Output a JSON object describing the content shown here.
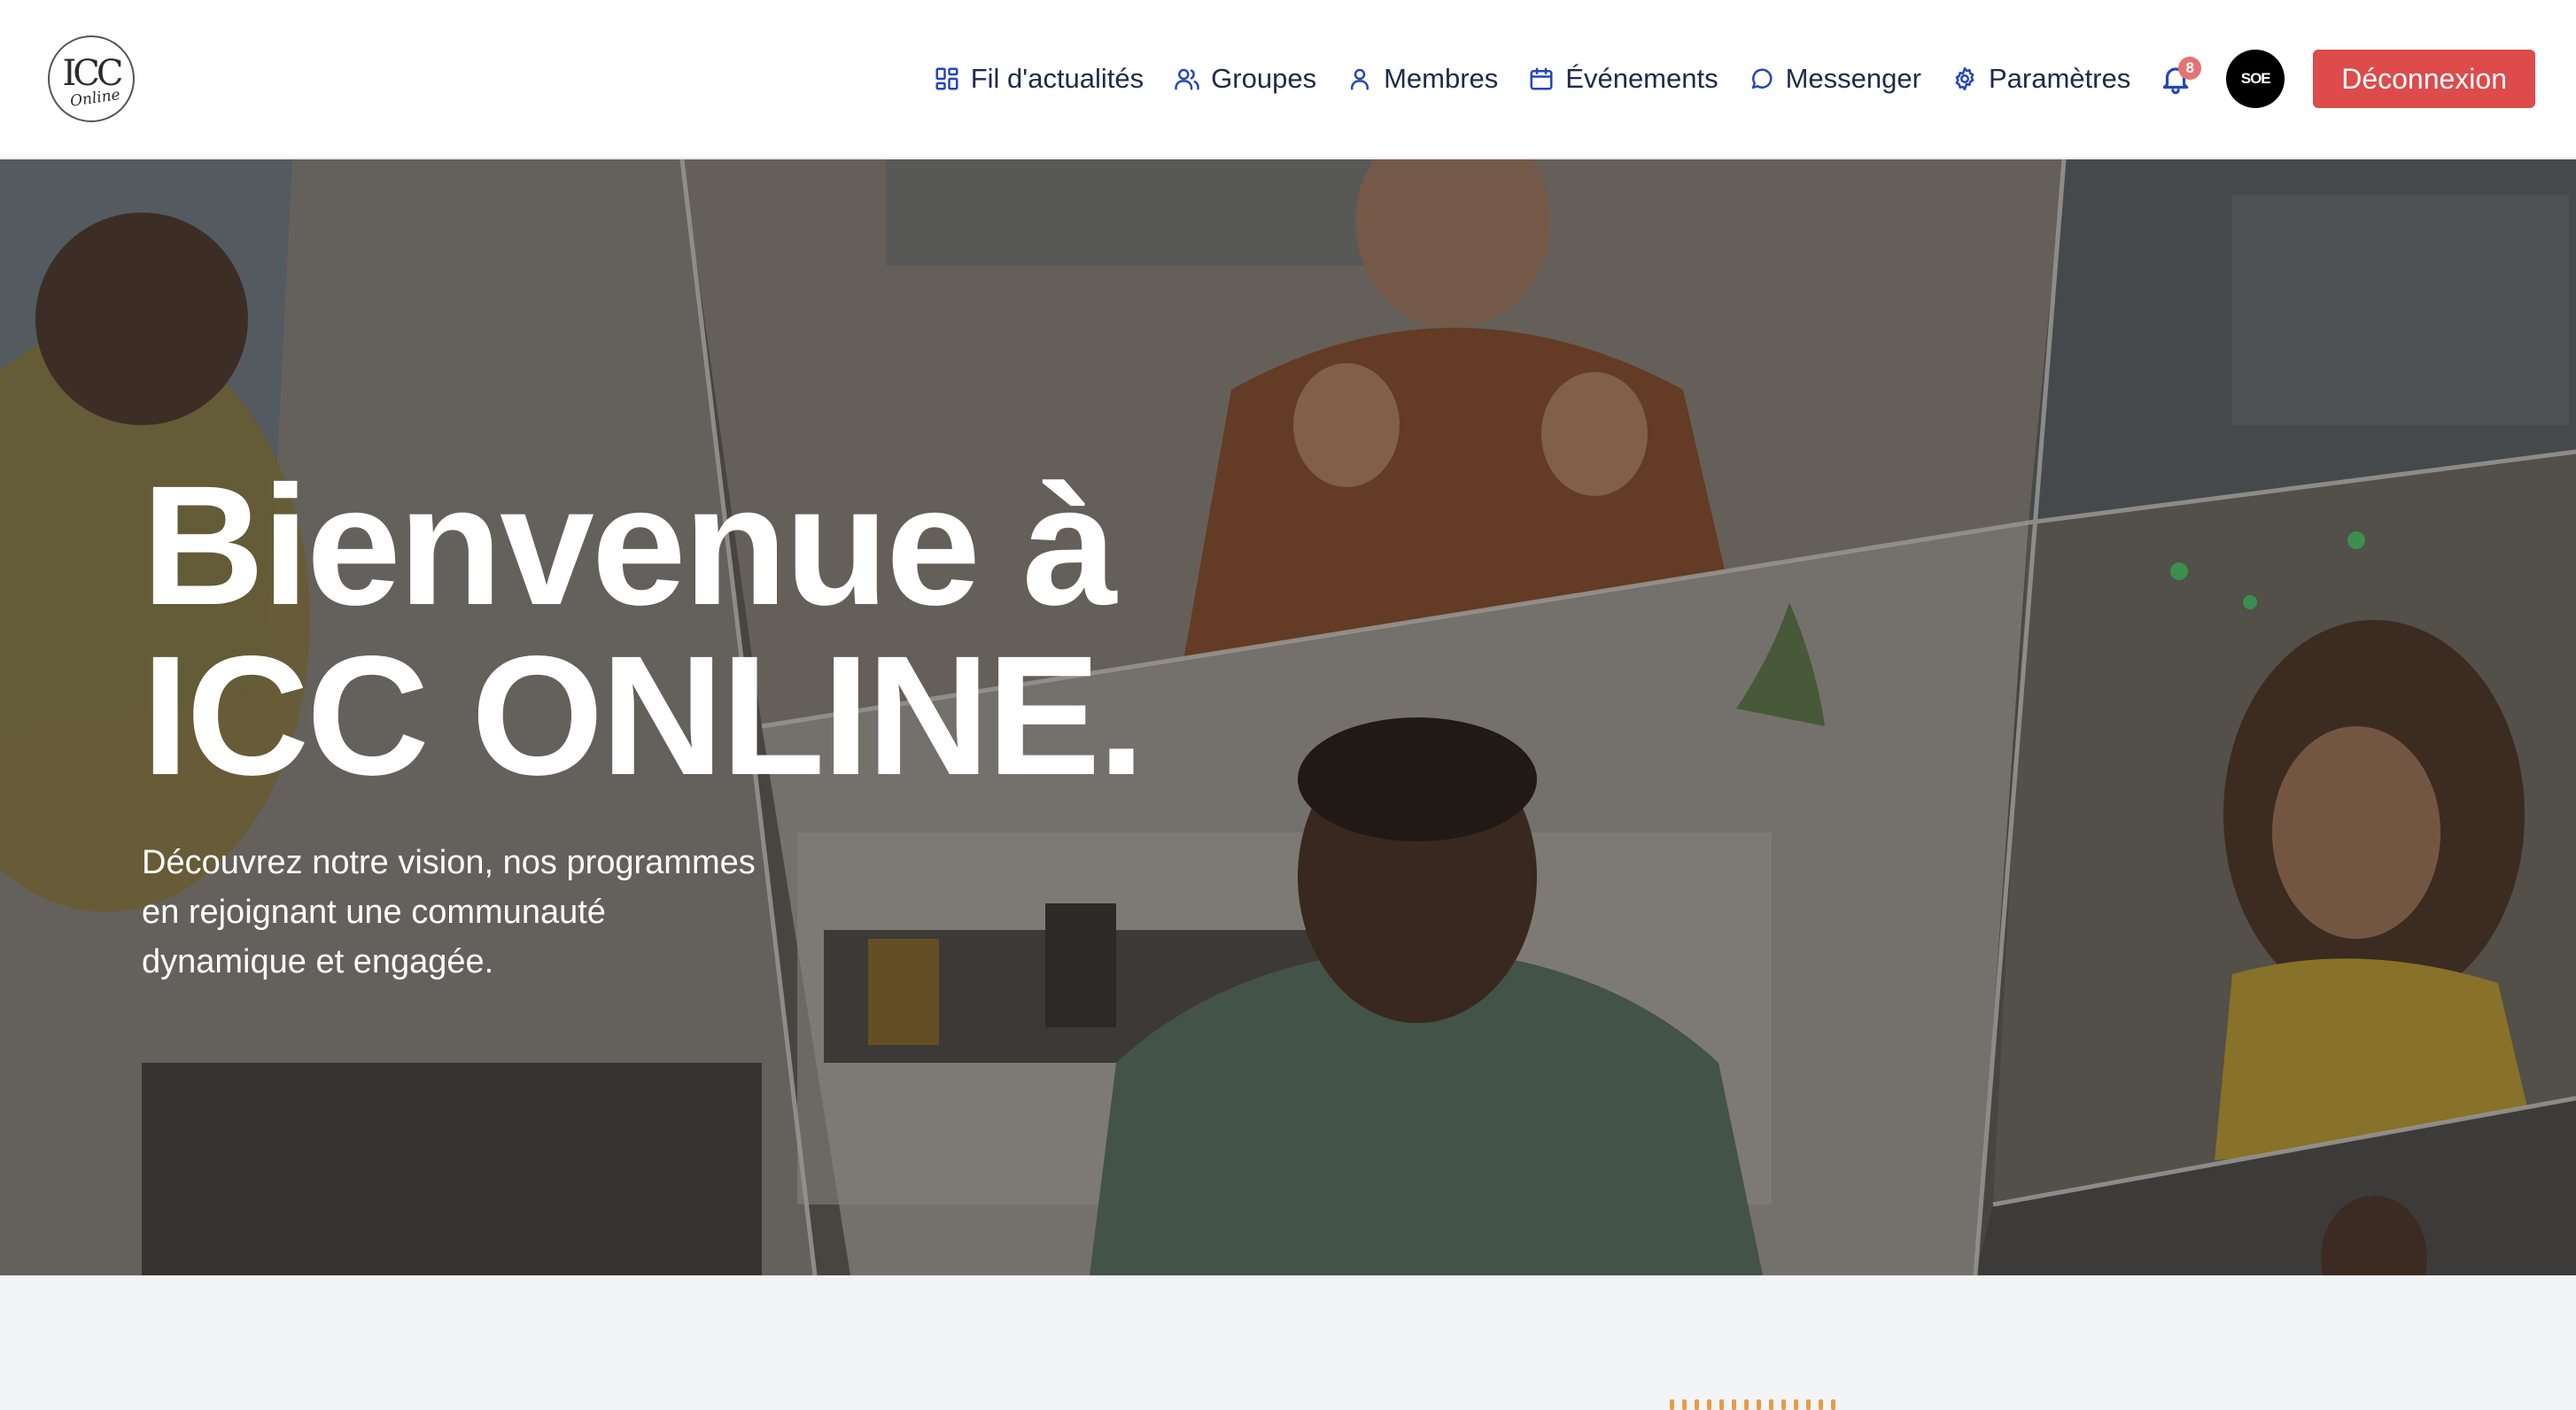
{
  "header": {
    "logo_text": "ICC",
    "logo_subtext": "Online",
    "nav": [
      {
        "label": "Fil d'actualités",
        "icon": "grid-icon"
      },
      {
        "label": "Groupes",
        "icon": "users-icon"
      },
      {
        "label": "Membres",
        "icon": "user-icon"
      },
      {
        "label": "Événements",
        "icon": "calendar-icon"
      },
      {
        "label": "Messenger",
        "icon": "chat-bubble-icon"
      },
      {
        "label": "Paramètres",
        "icon": "gear-icon"
      }
    ],
    "notifications_count": "8",
    "avatar_text": "SOE",
    "logout_label": "Déconnexion"
  },
  "hero": {
    "title_line1": "Bienvenue à",
    "title_line2": "ICC ONLINE.",
    "subtitle": "Découvrez notre vision, nos programmes en rejoignant une communauté dynamique et engagée."
  },
  "colors": {
    "accent": "#2546b9",
    "logout_button": "#dd4b4b",
    "badge": "#e57373",
    "page_background": "#f3f4f6"
  }
}
